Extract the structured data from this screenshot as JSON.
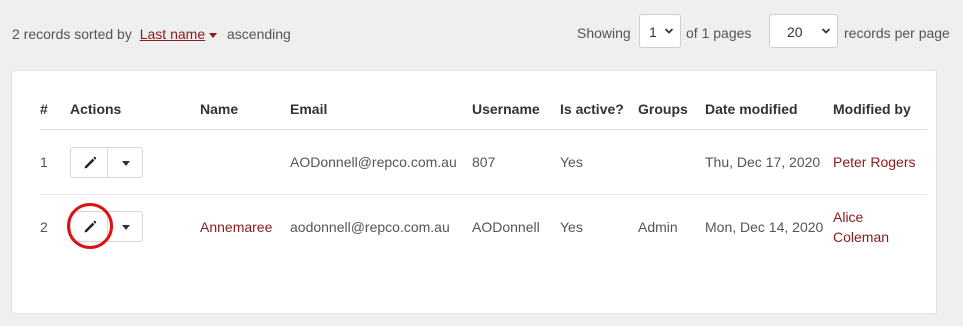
{
  "summary": {
    "prefix": "2 records sorted by",
    "sort_field": "Last name",
    "direction": "ascending"
  },
  "paging": {
    "showing_label": "Showing",
    "page_value": "1",
    "of_pages_label": "of 1 pages",
    "per_page_value": "20",
    "per_page_label": "records per page"
  },
  "table": {
    "headers": [
      "#",
      "Actions",
      "Name",
      "Email",
      "Username",
      "Is active?",
      "Groups",
      "Date modified",
      "Modified by"
    ],
    "rows": [
      {
        "num": "1",
        "name": "",
        "email": "AODonnell@repco.com.au",
        "username": "807",
        "active": "Yes",
        "groups": "",
        "date_modified": "Thu, Dec 17, 2020",
        "modified_by": "Peter Rogers"
      },
      {
        "num": "2",
        "name": "Annemaree",
        "email": "aodonnell@repco.com.au",
        "username": "AODonnell",
        "active": "Yes",
        "groups": "Admin",
        "date_modified": "Mon, Dec 14, 2020",
        "modified_by": "Alice Coleman"
      }
    ]
  },
  "icons": {
    "edit": "pencil-icon",
    "dropdown": "caret-down-icon"
  },
  "colors": {
    "link": "#8b1a1a",
    "highlight": "#e01010"
  }
}
